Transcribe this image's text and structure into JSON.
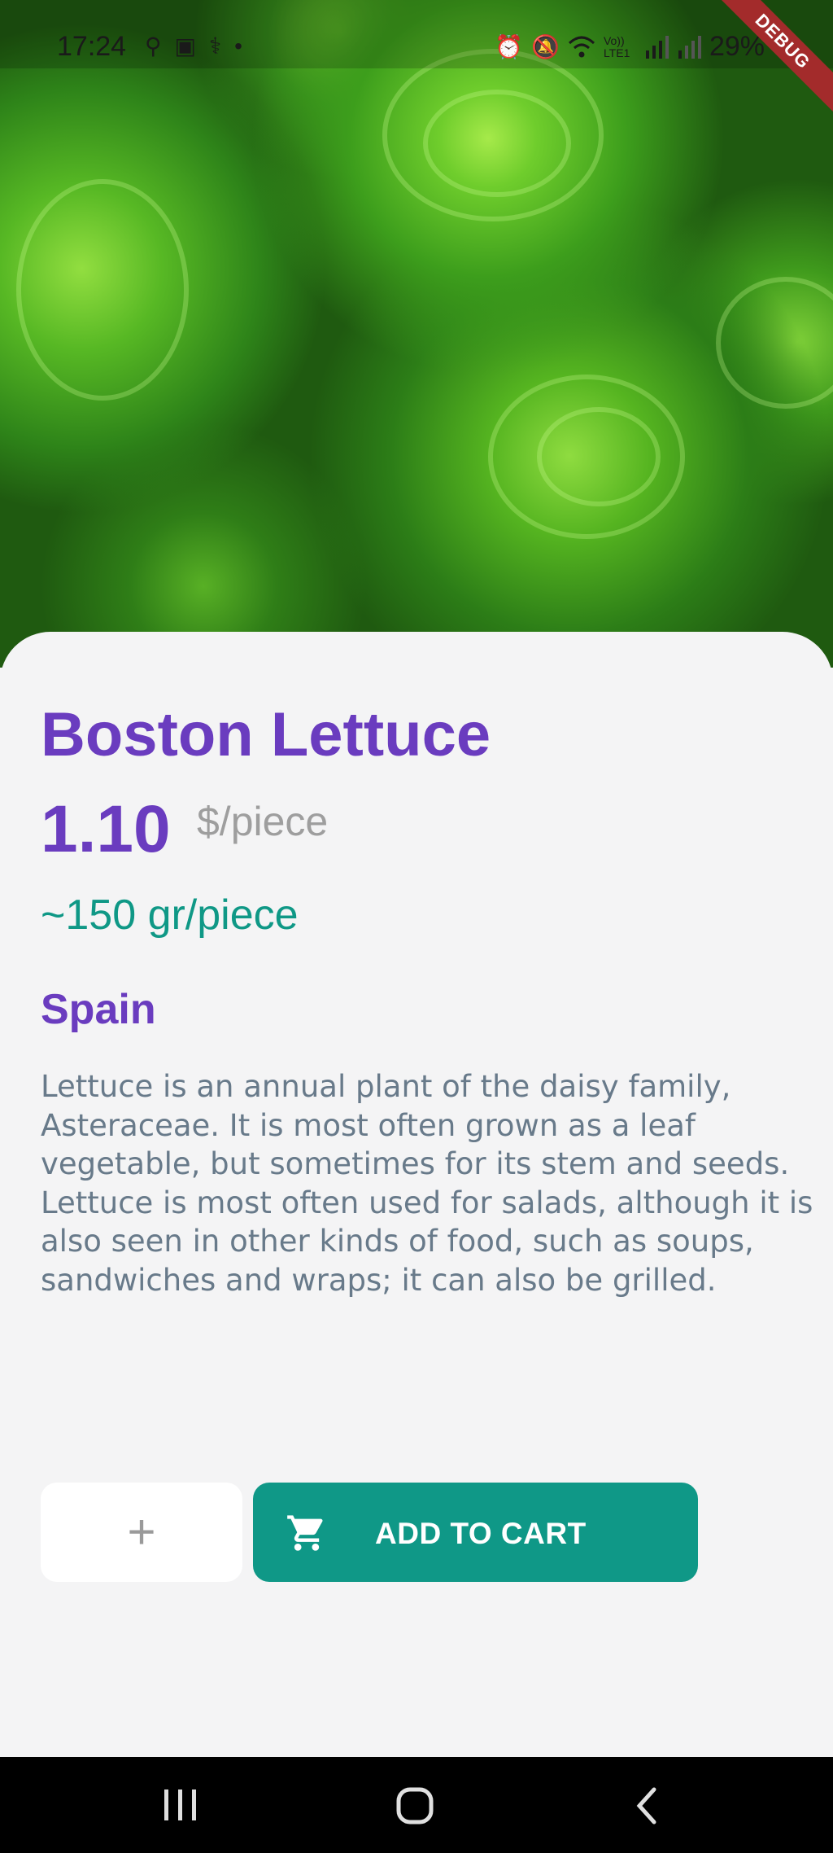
{
  "status_bar": {
    "time": "17:24",
    "left_icons": [
      "voicemail-icon",
      "image-icon",
      "walking-icon",
      "dot-icon"
    ],
    "battery_percent": "29%",
    "network_label": "Vo)) LTE1"
  },
  "debug_banner": "DEBUG",
  "product": {
    "name": "Boston Lettuce",
    "price": "1.10",
    "price_unit": "$/piece",
    "weight": "~150 gr/piece",
    "origin": "Spain",
    "description": "Lettuce is an annual plant of the daisy family, Asteraceae. It is most often grown as a leaf vegetable, but sometimes for its stem and seeds. Lettuce is most often used for salads, although it is also seen in other kinds of food, such as soups, sandwiches and wraps; it can also be grilled."
  },
  "actions": {
    "quantity_symbol": "+",
    "add_to_cart_label": "ADD TO CART"
  },
  "colors": {
    "accent_purple": "#6a3cbf",
    "accent_teal": "#0f9887",
    "muted_gray": "#9e9e9e",
    "body_text": "#687a8a"
  }
}
